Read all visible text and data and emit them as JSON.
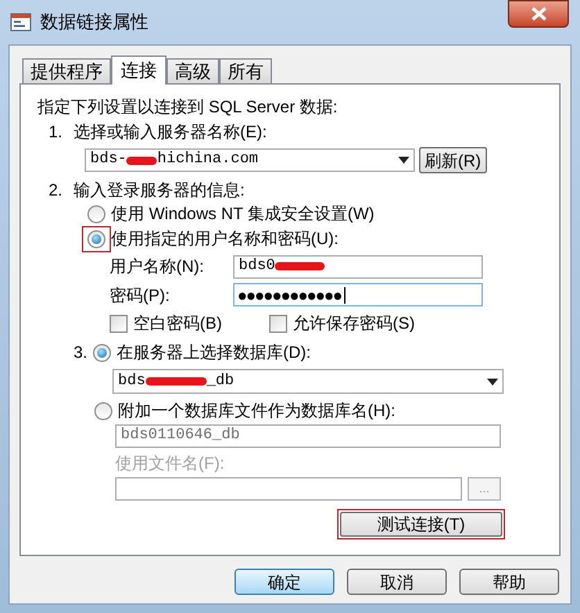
{
  "window": {
    "title": "数据链接属性"
  },
  "tabs": [
    {
      "label": "提供程序",
      "selected": false
    },
    {
      "label": "连接",
      "selected": true
    },
    {
      "label": "高级",
      "selected": false
    },
    {
      "label": "所有",
      "selected": false
    }
  ],
  "intro": "指定下列设置以连接到 SQL Server 数据:",
  "server": {
    "number": "1.",
    "label": "选择或输入服务器名称(E):",
    "value_start": "bds-",
    "value_end": "hichina.com",
    "refresh": "刷新(R)"
  },
  "login": {
    "number": "2.",
    "label": "输入登录服务器的信息:",
    "options": [
      {
        "label": "使用 Windows NT 集成安全设置(W)",
        "selected": false,
        "highlighted": false
      },
      {
        "label": "使用指定的用户名称和密码(U):",
        "selected": true,
        "highlighted": true
      }
    ],
    "username_label": "用户名称(N):",
    "username_value": "bds0",
    "password_label": "密码(P):",
    "password_value": "●●●●●●●●●●●●",
    "checkboxes": [
      {
        "label": "空白密码(B)",
        "checked": false
      },
      {
        "label": "允许保存密码(S)",
        "checked": false
      }
    ]
  },
  "database": {
    "number": "3.",
    "options": [
      {
        "label": "在服务器上选择数据库(D):",
        "selected": true
      },
      {
        "label": "附加一个数据库文件作为数据库名(H):",
        "selected": false
      }
    ],
    "db_value_start": "bds",
    "db_value_end": "_db",
    "attach_value": "bds0110646_db",
    "file_label": "使用文件名(F):",
    "browse": "...",
    "disabled": true,
    "test": {
      "label": "测试连接(T)",
      "highlighted": true
    }
  },
  "buttons": [
    {
      "label": "确定",
      "default": true
    },
    {
      "label": "取消",
      "default": false
    },
    {
      "label": "帮助",
      "default": false
    }
  ]
}
